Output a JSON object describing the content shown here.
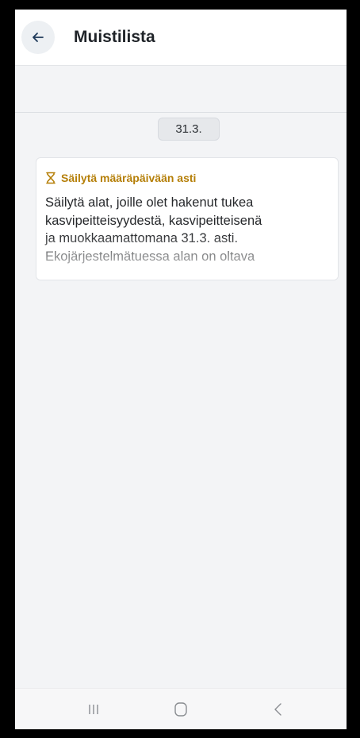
{
  "header": {
    "title": "Muistilista",
    "back_icon": "arrow-left-icon"
  },
  "reminder": {
    "date": "31.3.",
    "card": {
      "tag_icon": "hourglass-icon",
      "tag_label": "Säilytä määräpäivään asti",
      "tag_color": "#b57f08",
      "body_lines": [
        "Säilytä alat, joille olet hakenut tukea",
        "kasvipeitteisyydestä, kasvipeitteisenä",
        "ja muokkaamattomana 31.3. asti.",
        "Ekojärjestelmätuessa alan on oltava"
      ]
    }
  },
  "system_nav": {
    "recent_icon": "recent-apps-icon",
    "home_icon": "home-icon",
    "back_icon": "back-chevron-icon"
  }
}
